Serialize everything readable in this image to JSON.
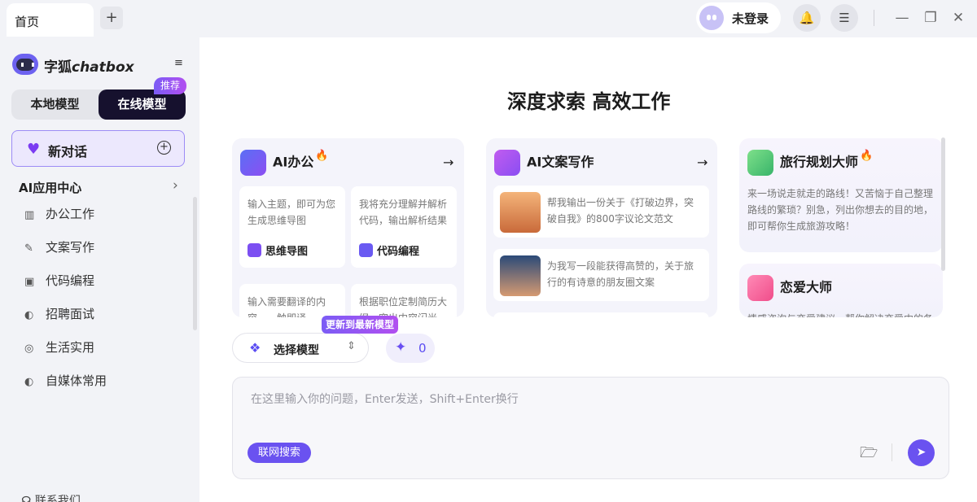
{
  "titlebar": {
    "tab": "首页",
    "new_tab": "+",
    "login": "未登录",
    "bell": "🔔",
    "list": "☰",
    "minimize": "—",
    "restore": "❐",
    "close": "✕"
  },
  "sidebar": {
    "brand_prefix": "字狐",
    "brand_suffix": "chatbox",
    "collapse": "≡",
    "tab_local": "本地模型",
    "tab_online": "在线模型",
    "recommend_badge": "推荐",
    "new_chat": "新对话",
    "new_chat_plus": "+",
    "section_title": "AI应用中心",
    "section_arrow": "›",
    "items": [
      {
        "label": "办公工作"
      },
      {
        "label": "文案写作"
      },
      {
        "label": "代码编程"
      },
      {
        "label": "招聘面试"
      },
      {
        "label": "生活实用"
      },
      {
        "label": "自媒体常用"
      }
    ],
    "contact": "联系我们"
  },
  "main": {
    "headline": "深度求索 高效工作",
    "office": {
      "title": "AI办公",
      "arrow": "→",
      "cards": [
        {
          "desc": "输入主题，即可为您生成思维导图",
          "title": "思维导图"
        },
        {
          "desc": "我将充分理解并解析代码，输出解析结果",
          "title": "代码编程"
        },
        {
          "desc": "输入需要翻译的内容，一触即译"
        },
        {
          "desc": "根据职位定制简历大纲，突出内容闪光"
        }
      ]
    },
    "writing": {
      "title": "AI文案写作",
      "arrow": "→",
      "items": [
        {
          "text": "帮我输出一份关于《打破边界，突破自我》的800字议论文范文"
        },
        {
          "text": "为我写一段能获得高赞的，关于旅行的有诗意的朋友圈文案"
        }
      ]
    },
    "travel": {
      "title": "旅行规划大师",
      "desc": "来一场说走就走的路线！又苦恼于自己整理路线的繁琐？别急，列出你想去的目的地，即可帮你生成旅游攻略！"
    },
    "love": {
      "title": "恋爱大师",
      "desc": "情感咨询与恋爱建议，帮你解决恋爱中的各种困惑"
    },
    "toolbar": {
      "update_badge": "更新到最新模型",
      "select_model": "选择模型",
      "updown": "⇕",
      "spark_count": "0"
    },
    "input": {
      "placeholder": "在这里输入你的问题，Enter发送，Shift+Enter换行",
      "value": "",
      "web_search": "联网搜索",
      "send": "➤",
      "folder": "🗁"
    }
  }
}
